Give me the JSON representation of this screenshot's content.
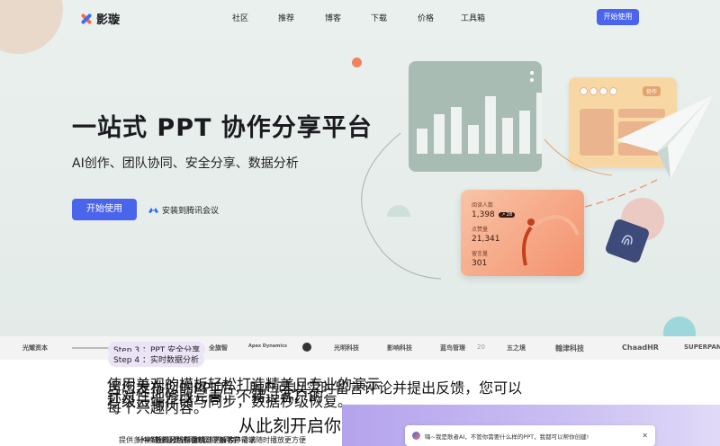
{
  "brand": {
    "name": "影璇"
  },
  "nav": {
    "items": [
      "社区",
      "推荐",
      "博客",
      "下载",
      "价格",
      "工具箱"
    ],
    "cta": "开始使用"
  },
  "hero": {
    "title": "一站式 PPT 协作分享平台",
    "subtitle": "AI创作、团队协同、安全分享、数据分析",
    "primary_cta": "开始使用",
    "secondary_cta": "安装到腾讯会议"
  },
  "illustration": {
    "analytics": [
      {
        "label": "阅读人数",
        "value": "1,398",
        "badge": "↗ 28"
      },
      {
        "label": "点赞量",
        "value": "21,341"
      },
      {
        "label": "留言量",
        "value": "301"
      }
    ],
    "collab_tag": "协作",
    "bar_chart": {
      "values": [
        0.35,
        0.55,
        0.65,
        0.4,
        0.8,
        0.5,
        0.6,
        0.85,
        0.55,
        0.3
      ]
    }
  },
  "partners": [
    "光耀资本",
    "",
    "",
    "全旗智",
    "Apex Dynamics",
    "",
    "光明科技",
    "影响科技",
    "蓝鸟管理",
    "20",
    "五之境",
    "翰津科技",
    "ChaadHR",
    "SUPERPANTS"
  ],
  "steps": {
    "step3": "Step 3 ：PPT 安全分享",
    "step4": "Step 4 ：实时数据分析"
  },
  "overlap_lines": [
    "使用美观的模板轻松打造精美且专业的演示",
    "当您发布您的PPT后，用户可以实时留言评论并提出反馈，您可以",
    "针对性地修改完善，不错过客户的",
    "每个兴趣内容。",
    "秒级云端存储与同步，数据秒级恢复。"
  ],
  "cta_heading": "从此刻开启你",
  "bullets": [
    "提供多种模板与风格指南",
    "分享链接设置访问权限和密码等",
    "数据分析帮你精准了解客户需求",
    "手机、平板等移动端随时播放更方便"
  ],
  "chat_widget": {
    "message": "嗨~我是歌者AI，不管你需要什么样的PPT，我都可以帮你创建!",
    "close": "✕"
  },
  "colors": {
    "accent": "#4a64ec",
    "orange": "#f2815e",
    "sage": "#a9bcb4",
    "lavender": "#ebe4f7"
  }
}
